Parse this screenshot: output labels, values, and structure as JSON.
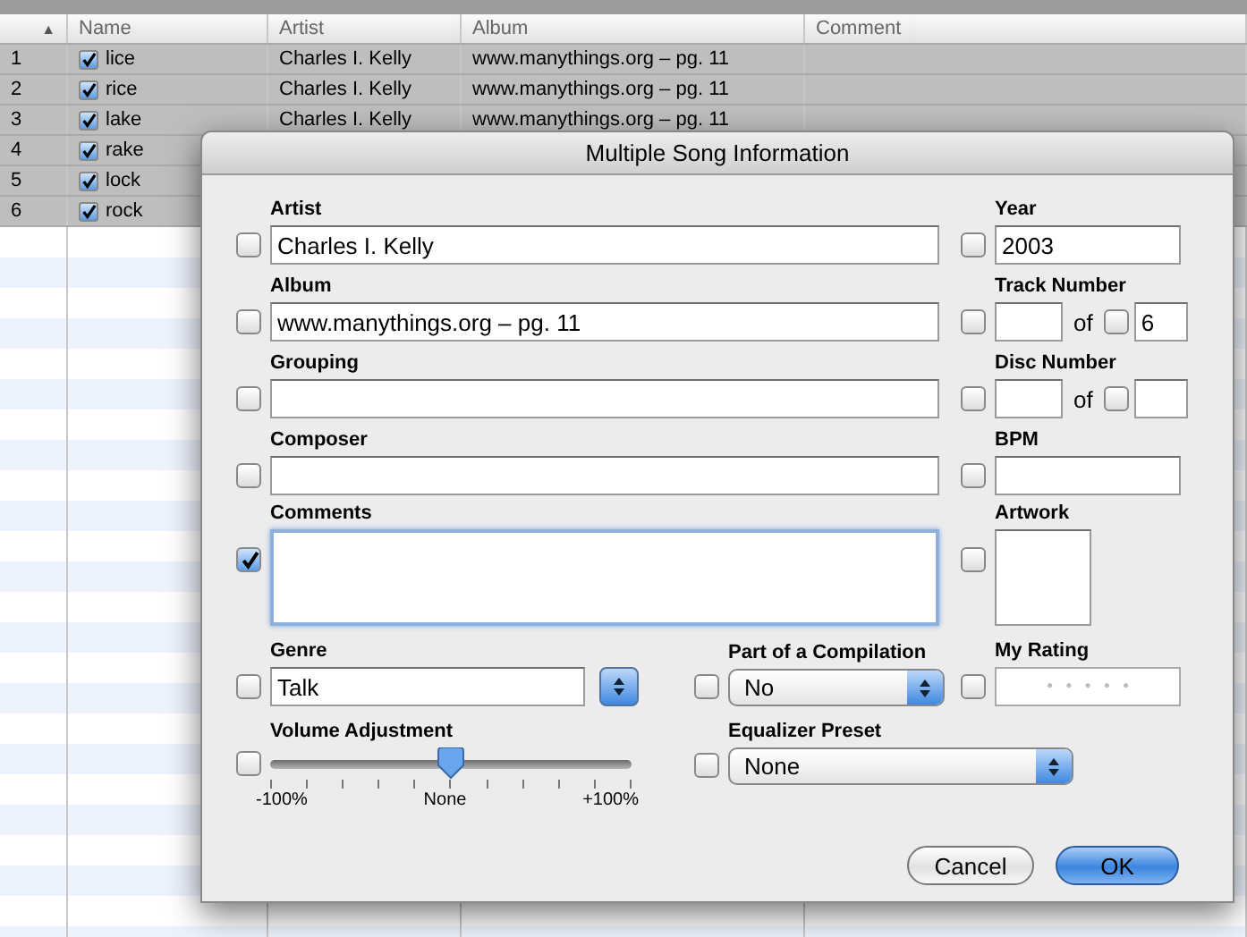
{
  "table": {
    "sort_indicator": "▲",
    "columns": [
      "Name",
      "Artist",
      "Album",
      "Comment"
    ],
    "rows": [
      {
        "index": "1",
        "name": "lice",
        "checked": true,
        "selected": true,
        "artist": "Charles I. Kelly",
        "album": "www.manythings.org – pg. 11"
      },
      {
        "index": "2",
        "name": "rice",
        "checked": true,
        "selected": true,
        "artist": "Charles I. Kelly",
        "album": "www.manythings.org – pg. 11"
      },
      {
        "index": "3",
        "name": "lake",
        "checked": true,
        "selected": true,
        "artist": "Charles I. Kelly",
        "album": "www.manythings.org – pg. 11"
      },
      {
        "index": "4",
        "name": "rake",
        "checked": true,
        "selected": true
      },
      {
        "index": "5",
        "name": "lock",
        "checked": true,
        "selected": true
      },
      {
        "index": "6",
        "name": "rock",
        "checked": true,
        "selected": true
      }
    ]
  },
  "dialog": {
    "title": "Multiple Song Information",
    "artist": {
      "label": "Artist",
      "checked": false,
      "value": "Charles I. Kelly"
    },
    "year": {
      "label": "Year",
      "checked": false,
      "value": "2003"
    },
    "album": {
      "label": "Album",
      "checked": false,
      "value": "www.manythings.org – pg. 11"
    },
    "track_number": {
      "label": "Track Number",
      "checked": false,
      "of": "of",
      "total_checked": false,
      "total": "6"
    },
    "grouping": {
      "label": "Grouping",
      "checked": false
    },
    "disc_number": {
      "label": "Disc Number",
      "checked": false,
      "of": "of",
      "total_checked": false
    },
    "composer": {
      "label": "Composer",
      "checked": false
    },
    "bpm": {
      "label": "BPM",
      "checked": false
    },
    "comments": {
      "label": "Comments",
      "checked": true
    },
    "artwork": {
      "label": "Artwork",
      "checked": false
    },
    "genre": {
      "label": "Genre",
      "checked": false,
      "value": "Talk"
    },
    "compilation": {
      "label": "Part of a Compilation",
      "checked": false,
      "value": "No"
    },
    "rating": {
      "label": "My Rating",
      "checked": false,
      "stars": 0
    },
    "volume": {
      "label": "Volume Adjustment",
      "checked": false,
      "level": 0.5,
      "tick_labels": [
        "-100%",
        "None",
        "+100%"
      ]
    },
    "equalizer": {
      "label": "Equalizer Preset",
      "checked": false,
      "value": "None"
    },
    "buttons": [
      {
        "label": "Cancel",
        "default": false
      },
      {
        "label": "OK",
        "default": true
      }
    ]
  }
}
